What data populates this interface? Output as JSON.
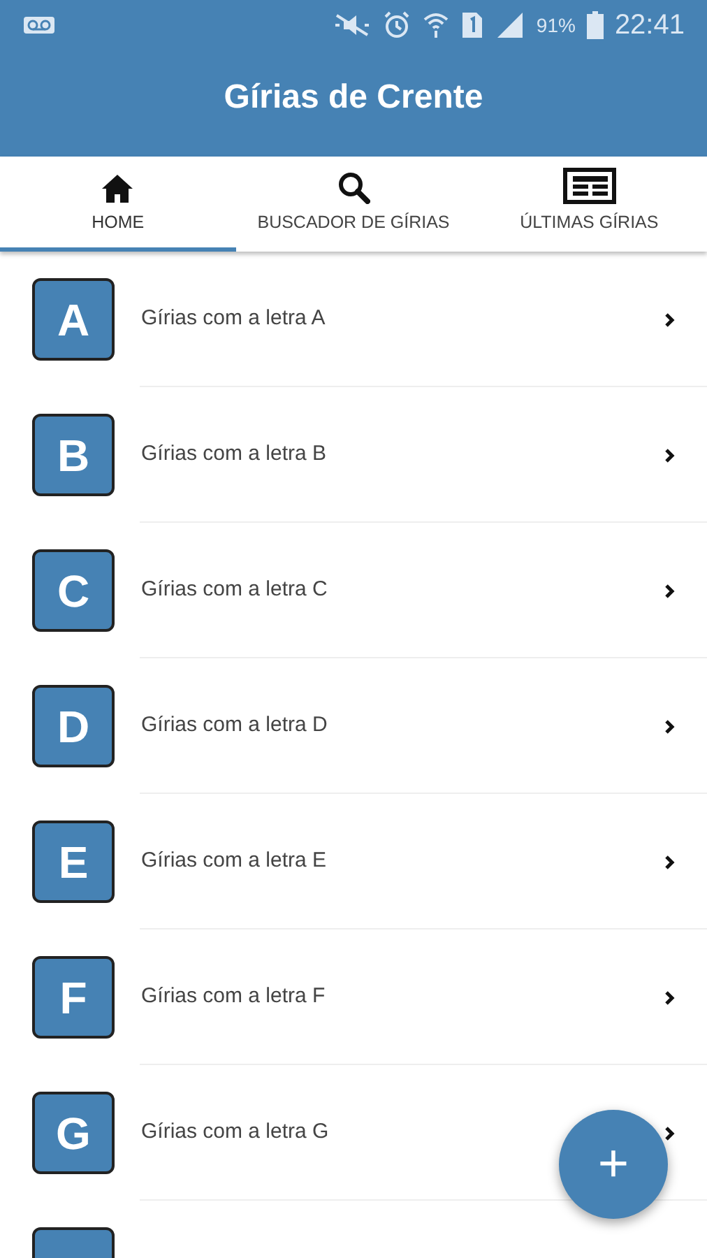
{
  "status_bar": {
    "battery": "91%",
    "time": "22:41"
  },
  "app_bar": {
    "title": "Gírias de Crente"
  },
  "tabs": [
    {
      "label": "HOME",
      "kind": "home",
      "selected": true
    },
    {
      "label": "BUSCADOR DE GÍRIAS",
      "kind": "search",
      "selected": false
    },
    {
      "label": "ÚLTIMAS GÍRIAS",
      "kind": "news",
      "selected": false
    }
  ],
  "items": [
    {
      "kind": "row",
      "letter": "A",
      "label": "Gírias com a letra A"
    },
    {
      "kind": "row",
      "letter": "B",
      "label": "Gírias com a letra B"
    },
    {
      "kind": "row",
      "letter": "C",
      "label": "Gírias com a letra C"
    },
    {
      "kind": "row",
      "letter": "D",
      "label": "Gírias com a letra D"
    },
    {
      "kind": "row",
      "letter": "E",
      "label": "Gírias com a letra E"
    },
    {
      "kind": "row",
      "letter": "F",
      "label": "Gírias com a letra F"
    },
    {
      "kind": "row",
      "letter": "G",
      "label": "Gírias com a letra G"
    },
    {
      "kind": "partial"
    }
  ],
  "fab": {
    "label": "+"
  }
}
